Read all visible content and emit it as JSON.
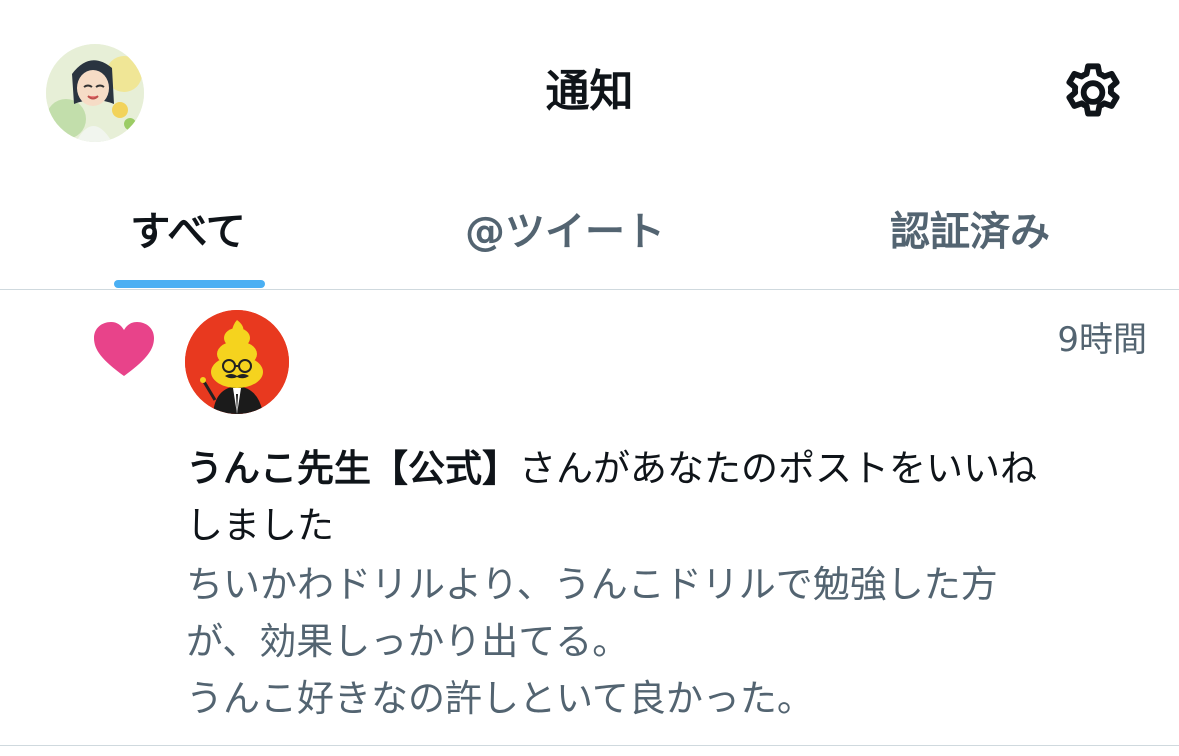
{
  "header": {
    "title": "通知",
    "settings_icon": "gear-icon",
    "avatar_icon": "profile-avatar"
  },
  "tabs": [
    {
      "label": "すべて",
      "active": true
    },
    {
      "label": "@ツイート",
      "active": false
    },
    {
      "label": "認証済み",
      "active": false
    }
  ],
  "notification": {
    "type_icon": "heart-icon",
    "time": "9時間",
    "actor_name": "うんこ先生【公式】",
    "action_text": "さんがあなたのポストをいいね",
    "action_text_cont": "しました",
    "post_lines": [
      "ちいかわドリルより、うんこドリルで勉強した方",
      "が、効果しっかり出てる。",
      "うんこ好きなの許しといて良かった。"
    ]
  },
  "colors": {
    "accent": "#1d9bf0",
    "like": "#e8438a",
    "secondary_text": "#536471",
    "avatar_bg": "#e8391f"
  }
}
